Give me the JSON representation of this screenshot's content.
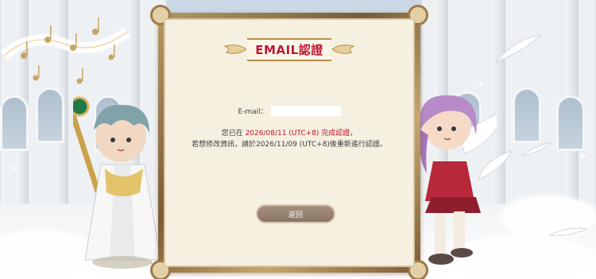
{
  "title": "EMAIL認證",
  "email_label": "E-mail：",
  "email_value": "",
  "line1_prefix": "您已在 ",
  "line1_date": "2026/08/11 (UTC+8) 完成認證",
  "line1_suffix": "，",
  "line2": "若想修改資訊，請於2026/11/09 (UTC+8)後重新進行認證。",
  "back_button_label": "返回",
  "colors": {
    "accent": "#c0152b",
    "frame": "#7b5b36",
    "panel": "#f6f0e1",
    "button": "#8a7462"
  },
  "icons": {
    "decor_left": "music-notes-icon",
    "decor_right": "feather-icon"
  }
}
